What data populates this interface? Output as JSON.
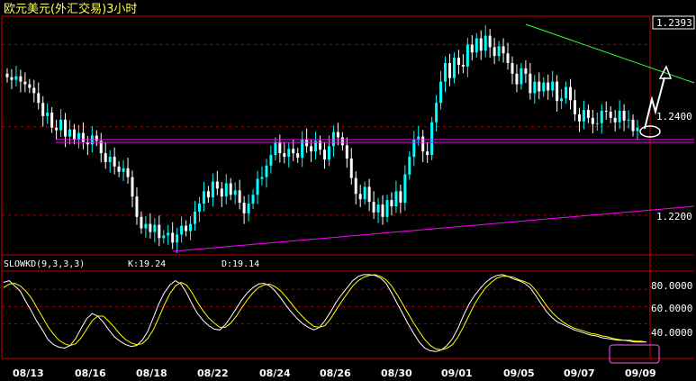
{
  "title": "欧元美元(外汇交易)3小时",
  "colors": {
    "background": "#000000",
    "frame": "#cc0000",
    "grid": "#aa0000",
    "bull": "#00ffff",
    "bear": "#ffffff",
    "k_line": "#ffffff",
    "d_line": "#ffff00",
    "support_line": "#ff00ff",
    "resistance_line": "#33ff33",
    "marker": "#ffffff",
    "highlight": "#ff55ff",
    "title": "#ffff55"
  },
  "price_axis": {
    "labels": [
      "1.2393",
      "1.2400",
      "1.2200"
    ],
    "values": [
      1.2393,
      1.23,
      1.22
    ]
  },
  "indicator": {
    "name": "SLOWKD(9,3,3,3)",
    "k_text": "K:19.24",
    "d_text": "D:19.14",
    "axis_labels": [
      "80.0000",
      "60.0000",
      "40.0000"
    ],
    "axis_values": [
      80,
      60,
      40
    ]
  },
  "x_axis": {
    "labels": [
      "08/13",
      "08/16",
      "08/18",
      "08/22",
      "08/24",
      "08/26",
      "08/30",
      "09/01",
      "09/05",
      "09/07",
      "09/09"
    ]
  },
  "chart_data": [
    {
      "type": "candlestick",
      "title": "欧元美元(外汇交易)3小时",
      "ylim": [
        1.2155,
        1.2425
      ],
      "grid": true,
      "closes": [
        1.2356,
        1.2353,
        1.2357,
        1.2351,
        1.2348,
        1.2344,
        1.2338,
        1.2327,
        1.2312,
        1.2316,
        1.2299,
        1.2296,
        1.2308,
        1.2289,
        1.2297,
        1.2286,
        1.2293,
        1.2282,
        1.228,
        1.229,
        1.2284,
        1.227,
        1.226,
        1.2266,
        1.2255,
        1.2249,
        1.2253,
        1.2243,
        1.2221,
        1.2198,
        1.2185,
        1.219,
        1.2181,
        1.2189,
        1.2174,
        1.2177,
        1.218,
        1.2169,
        1.2178,
        1.2188,
        1.2182,
        1.219,
        1.2204,
        1.2213,
        1.2227,
        1.222,
        1.2238,
        1.223,
        1.2221,
        1.2236,
        1.2223,
        1.2228,
        1.2214,
        1.2202,
        1.2213,
        1.2223,
        1.2241,
        1.2243,
        1.2256,
        1.2268,
        1.2282,
        1.227,
        1.2266,
        1.2275,
        1.227,
        1.2265,
        1.2286,
        1.2278,
        1.2272,
        1.2284,
        1.2274,
        1.2263,
        1.2278,
        1.2294,
        1.2288,
        1.2279,
        1.2264,
        1.2242,
        1.2224,
        1.2218,
        1.2232,
        1.2215,
        1.2203,
        1.2212,
        1.2198,
        1.2217,
        1.221,
        1.2227,
        1.2214,
        1.2246,
        1.2266,
        1.2286,
        1.2289,
        1.2272,
        1.2268,
        1.2305,
        1.2327,
        1.2351,
        1.2372,
        1.2355,
        1.2378,
        1.237,
        1.2368,
        1.2393,
        1.2384,
        1.24,
        1.2386,
        1.2403,
        1.239,
        1.238,
        1.2391,
        1.2383,
        1.2372,
        1.236,
        1.2348,
        1.2366,
        1.236,
        1.2338,
        1.2351,
        1.234,
        1.235,
        1.2341,
        1.2351,
        1.2329,
        1.2332,
        1.2345,
        1.233,
        1.2314,
        1.2306,
        1.2319,
        1.231,
        1.2303,
        1.2304,
        1.2318,
        1.2317,
        1.231,
        1.2305,
        1.2318,
        1.2307,
        1.2308,
        1.2295,
        1.2299
      ]
    },
    {
      "type": "line",
      "title": "SLOWKD(9,3,3,3)",
      "ylim": [
        0,
        100
      ],
      "series": [
        {
          "name": "K",
          "values": [
            88,
            90,
            84,
            78,
            66,
            55,
            43,
            33,
            22,
            16,
            13,
            12,
            15,
            23,
            35,
            46,
            52,
            49,
            42,
            33,
            25,
            20,
            16,
            14,
            15,
            21,
            31,
            47,
            63,
            76,
            85,
            90,
            86,
            76,
            63,
            52,
            44,
            38,
            34,
            33,
            39,
            48,
            58,
            68,
            76,
            82,
            86,
            87,
            84,
            78,
            70,
            61,
            53,
            46,
            40,
            36,
            33,
            36,
            44,
            54,
            65,
            74,
            82,
            90,
            95,
            97,
            97,
            96,
            93,
            87,
            76,
            64,
            52,
            40,
            29,
            19,
            12,
            9,
            8,
            10,
            15,
            23,
            35,
            50,
            63,
            73,
            81,
            88,
            93,
            96,
            97,
            95,
            92,
            90,
            87,
            82,
            73,
            63,
            54,
            47,
            42,
            39,
            36,
            33,
            31,
            29,
            27,
            26,
            24,
            23,
            22,
            21,
            21,
            20,
            19,
            19,
            19
          ]
        },
        {
          "name": "D",
          "values": [
            82,
            86,
            87,
            84,
            78,
            70,
            59,
            48,
            37,
            28,
            21,
            17,
            15,
            17,
            24,
            34,
            44,
            49,
            49,
            43,
            36,
            28,
            22,
            18,
            16,
            17,
            23,
            33,
            47,
            62,
            75,
            84,
            88,
            85,
            76,
            65,
            55,
            47,
            41,
            36,
            36,
            41,
            49,
            59,
            68,
            76,
            82,
            85,
            86,
            83,
            78,
            71,
            63,
            55,
            48,
            42,
            37,
            36,
            38,
            46,
            56,
            66,
            75,
            84,
            90,
            94,
            96,
            97,
            95,
            91,
            84,
            74,
            63,
            52,
            41,
            31,
            22,
            15,
            11,
            10,
            12,
            16,
            25,
            37,
            50,
            63,
            73,
            82,
            88,
            93,
            95,
            95,
            94,
            91,
            89,
            86,
            79,
            70,
            61,
            53,
            47,
            42,
            38,
            35,
            33,
            31,
            29,
            28,
            26,
            25,
            23,
            22,
            21,
            21,
            20,
            20,
            19
          ]
        }
      ],
      "k_value": 19.24,
      "d_value": 19.14
    }
  ]
}
